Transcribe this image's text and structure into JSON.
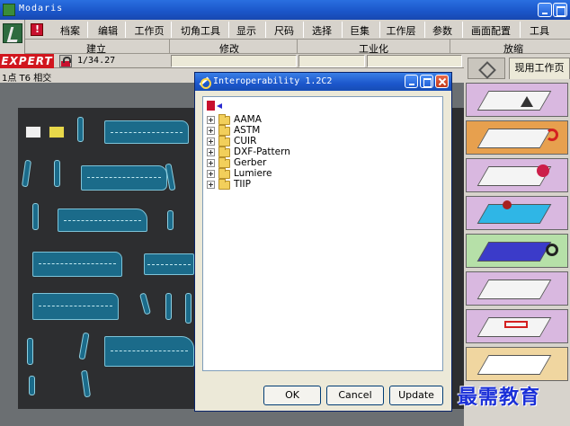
{
  "window": {
    "title": "Modaris"
  },
  "menu": {
    "items": [
      "档案",
      "编辑",
      "工作页",
      "切角工具",
      "显示",
      "尺码",
      "选择",
      "巨集",
      "工作层",
      "参数",
      "画面配置",
      "工具"
    ]
  },
  "sections": [
    "建立",
    "修改",
    "工业化",
    "放缩"
  ],
  "status": {
    "badge": "EXPERT",
    "value": "1/34.27"
  },
  "info": {
    "text": "1点 T6 相交"
  },
  "right_panel": {
    "tab_label": "现用工作页"
  },
  "dialog": {
    "title": "Interoperability 1.2C2",
    "folders": [
      "AAMA",
      "ASTM",
      "CUIR",
      "DXF-Pattern",
      "Gerber",
      "Lumiere",
      "TIIP"
    ],
    "buttons": {
      "ok": "OK",
      "cancel": "Cancel",
      "update": "Update"
    }
  },
  "watermark": "最需教育",
  "colors": {
    "title_bar": "#1a55c8",
    "piece_fill": "#1b6b8a",
    "board": "#2d2e30",
    "badge": "#d1161e"
  },
  "icons": [
    "app-icon",
    "logo-icon",
    "red-alert-icon",
    "lock-icon",
    "back-arrow-icon",
    "folder-icon",
    "expand-icon"
  ]
}
